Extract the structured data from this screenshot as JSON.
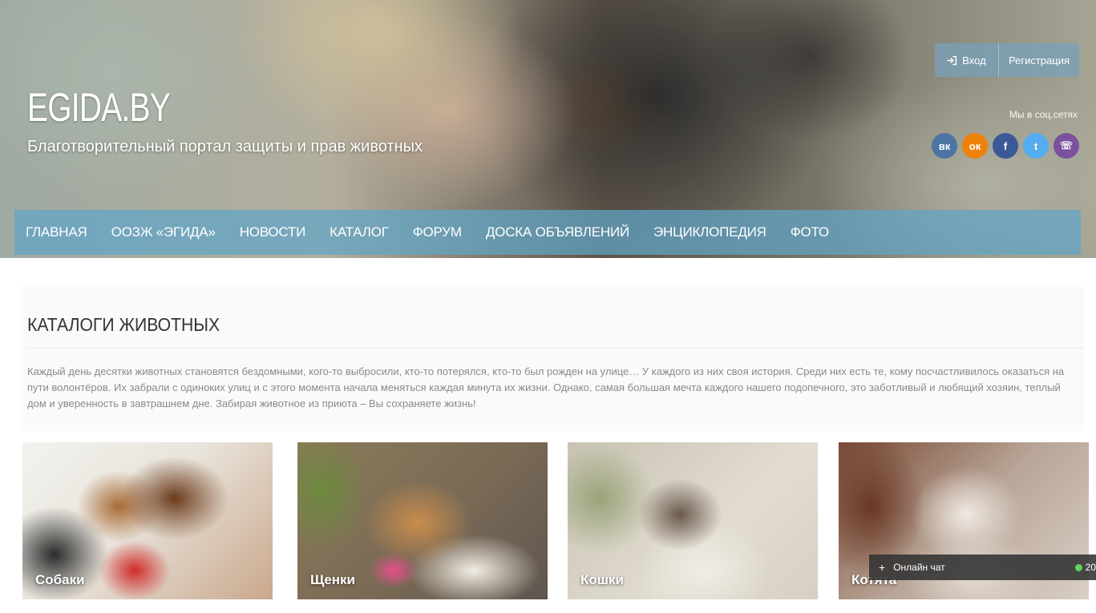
{
  "header": {
    "logo": "EGIDA.BY",
    "tagline": "Благотворительный портал защиты и прав животных",
    "auth": {
      "login_label": "Вход",
      "register_label": "Регистрация"
    },
    "social": {
      "label": "Мы в соц.сетях",
      "items": [
        {
          "name": "vk-icon",
          "glyph": "вк",
          "color": "#4c75a3"
        },
        {
          "name": "odnoklassniki-icon",
          "glyph": "ок",
          "color": "#ee8208"
        },
        {
          "name": "facebook-icon",
          "glyph": "f",
          "color": "#3b5998"
        },
        {
          "name": "twitter-icon",
          "glyph": "t",
          "color": "#55acee"
        },
        {
          "name": "viber-icon",
          "glyph": "☏",
          "color": "#7b519d"
        }
      ]
    }
  },
  "nav": {
    "items": [
      "Главная",
      "ООЗЖ «Эгида»",
      "Новости",
      "Каталог",
      "Форум",
      "Доска объявлений",
      "Энциклопедия",
      "Фото"
    ]
  },
  "intro": {
    "title": "КАТАЛОГИ ЖИВОТНЫХ",
    "text": "Каждый день десятки животных становятся бездомными, кого-то выбросили, кто-то потерялся, кто-то был рожден на улице… У каждого из них своя история. Среди них есть те, кому посчастливилось оказаться на пути волонтёров. Их забрали с одиноких улиц и с этого момента начала меняться каждая минута их жизни. Однако, самая большая мечта каждого нашего подопечного, это заботливый и любящий хозяин, теплый дом и уверенность в завтрашнем дне. Забирая животное из приюта – Вы сохраняете жизнь!"
  },
  "cards": [
    {
      "label": "Собаки"
    },
    {
      "label": "Щенки"
    },
    {
      "label": "Кошки"
    },
    {
      "label": "Котята"
    }
  ],
  "chat": {
    "label": "Онлайн чат",
    "count": "20"
  },
  "colors": {
    "nav_bg": "#5fa5c8",
    "intro_text": "#8a8a8a",
    "online": "#5fd35f"
  }
}
